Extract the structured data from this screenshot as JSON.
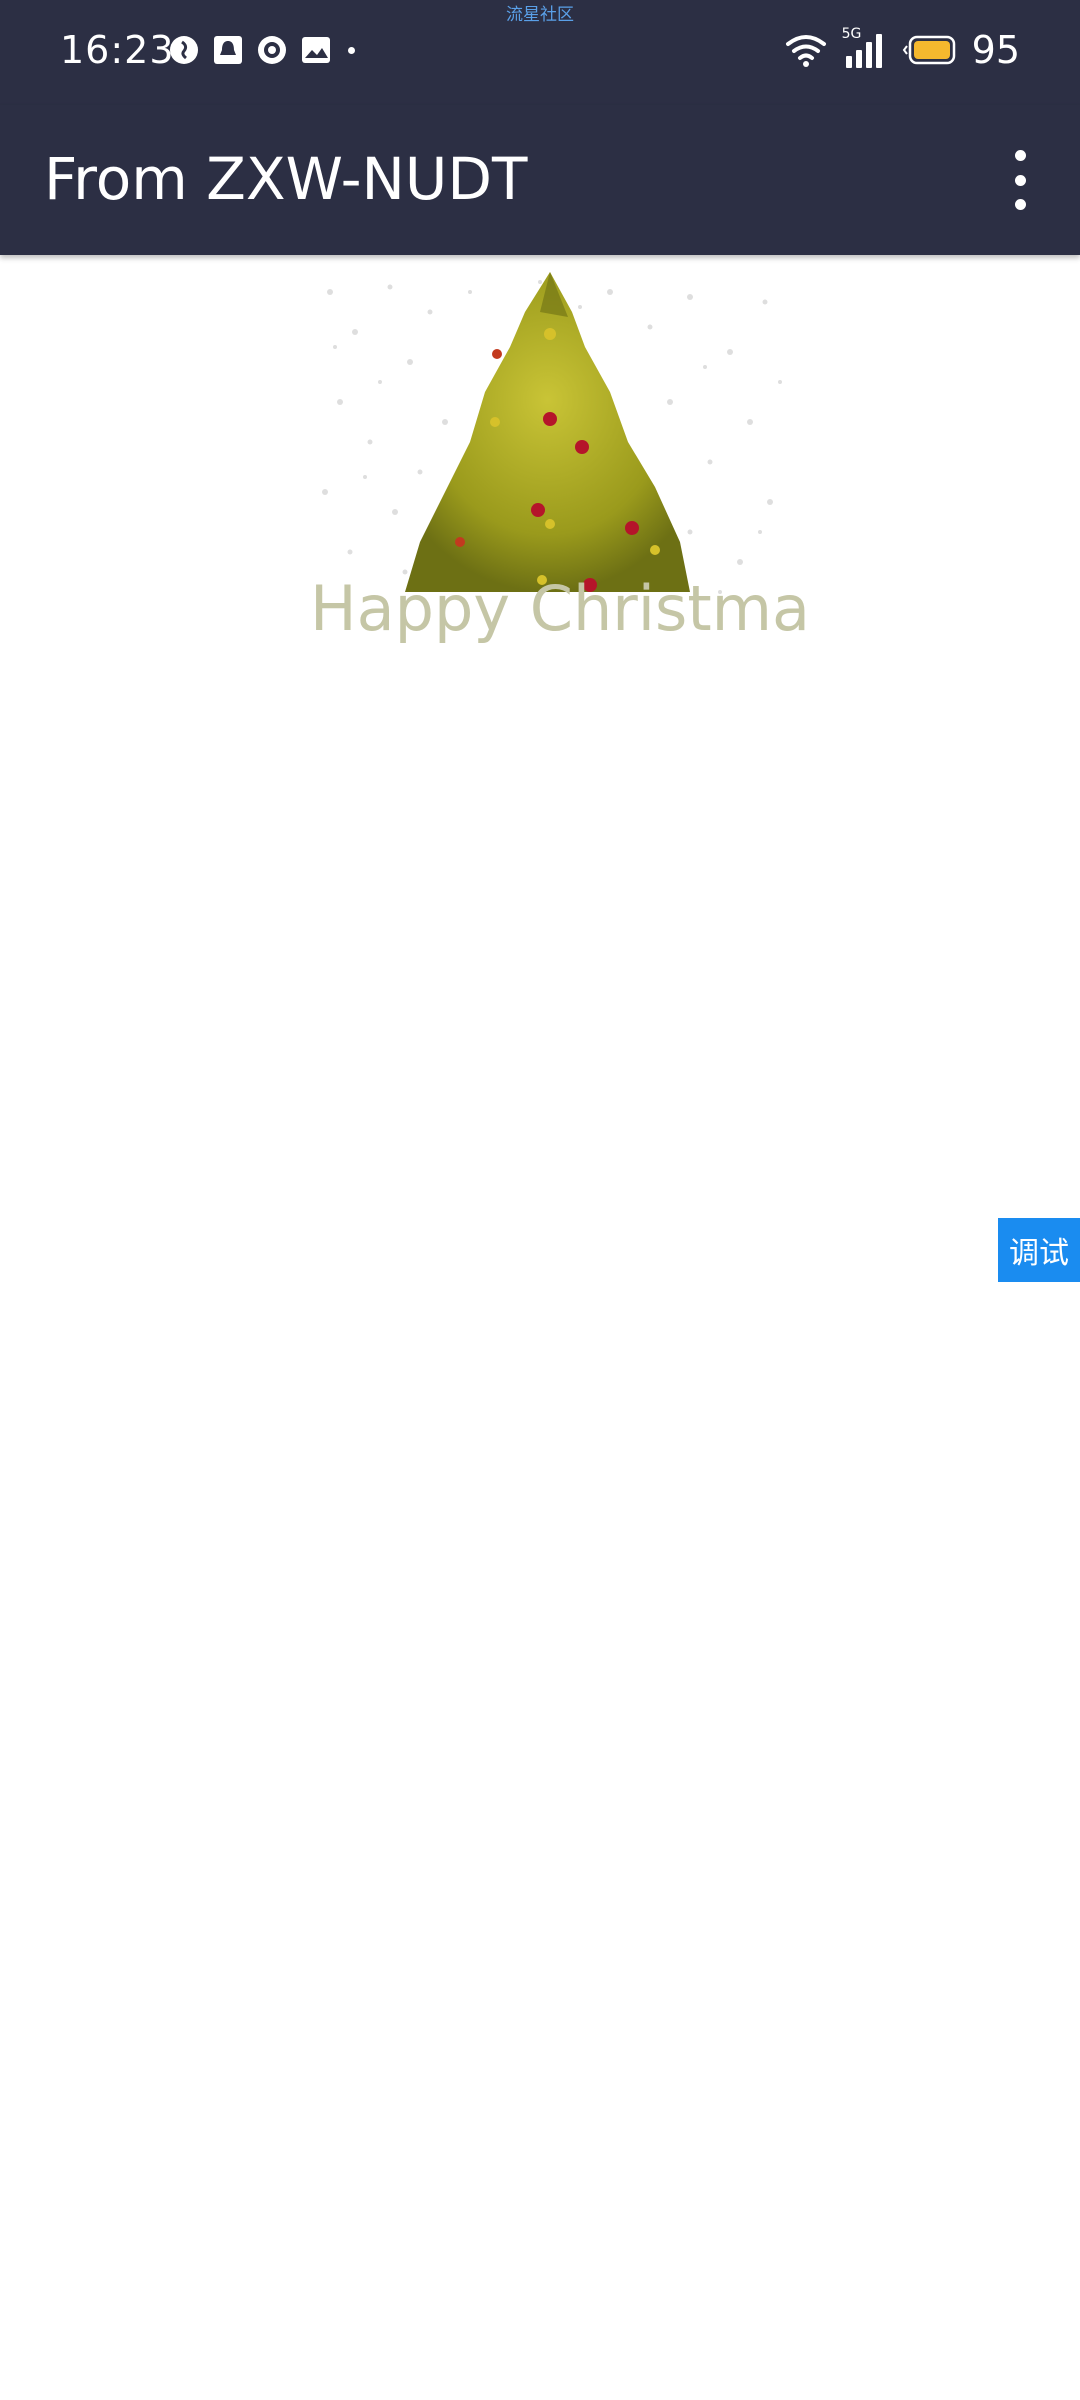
{
  "status_bar": {
    "center_label": "流星社区",
    "time": "16:23",
    "battery_level": "95",
    "network_label": "5G",
    "icons_left": [
      "location-icon",
      "notification-bell-icon",
      "record-icon",
      "gallery-icon"
    ],
    "icons_right": [
      "wifi-icon",
      "signal-icon",
      "battery-icon"
    ],
    "battery_color": "#f5b82e"
  },
  "app_bar": {
    "title": "From ZXW-NUDT",
    "background": "#2c2f44"
  },
  "content": {
    "image_name": "christmas-tree-image",
    "caption": "Happy Christma"
  },
  "debug_button": {
    "label": "调试",
    "background": "#1a8cf0"
  }
}
